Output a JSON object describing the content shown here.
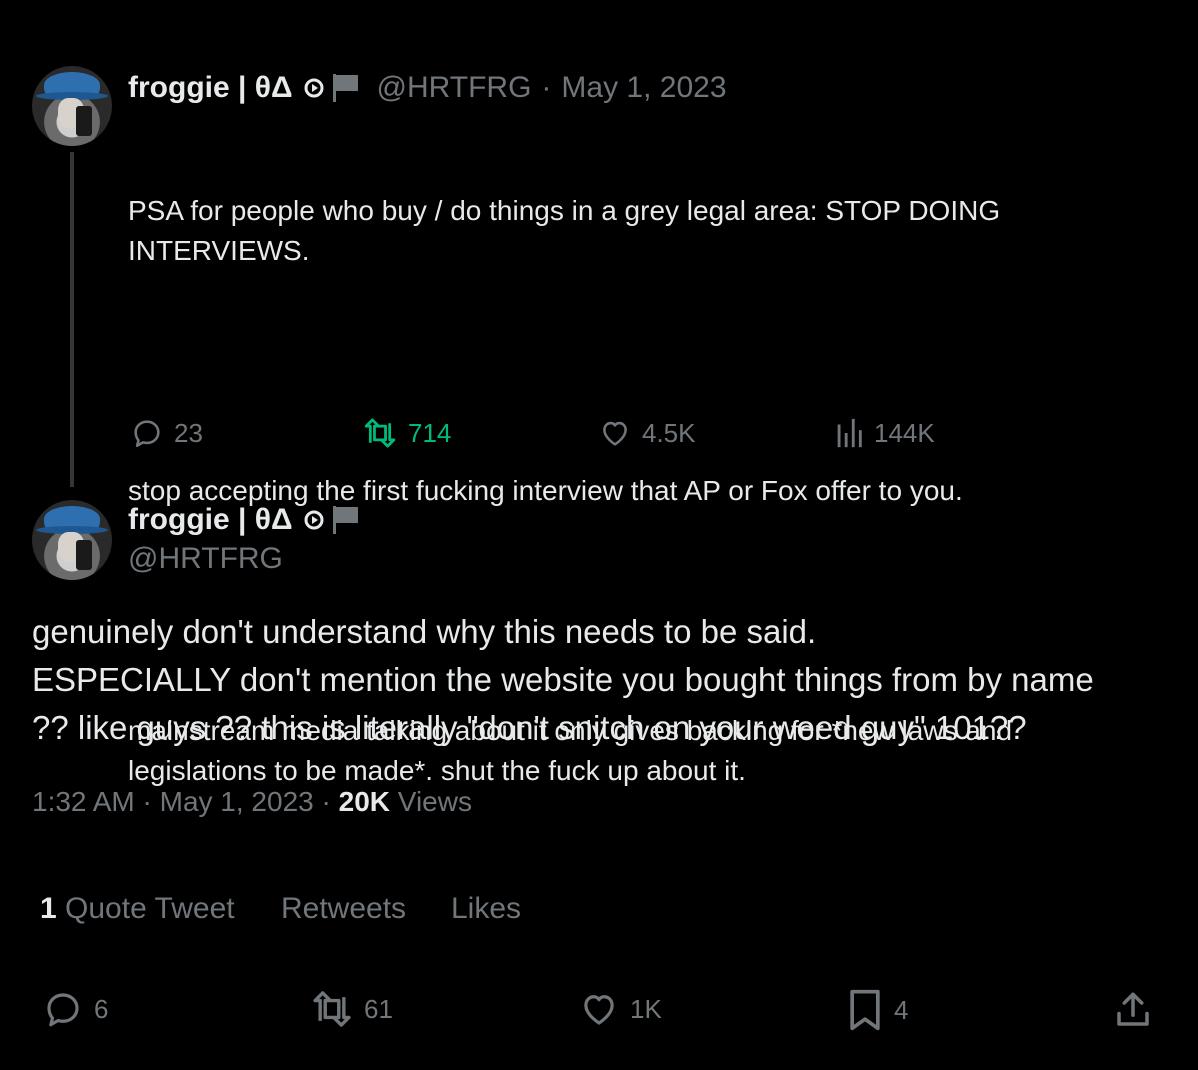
{
  "original_tweet": {
    "display_name": "froggie | θΔ",
    "handle": "@HRTFRG",
    "date_sep": "·",
    "date": "May 1, 2023",
    "paragraphs": [
      "PSA for people who buy / do things in a grey legal area: STOP DOING\nINTERVIEWS.",
      "stop accepting the first fucking interview that AP or Fox offer to you.",
      "mainstream media talking about it only gives backing for *new laws and\nlegislations to be made*. shut the fuck up about it."
    ],
    "stats": {
      "replies": "23",
      "retweets": "714",
      "likes": "4.5K",
      "views": "144K"
    }
  },
  "reply_tweet": {
    "display_name": "froggie | θΔ",
    "handle": "@HRTFRG",
    "text": "genuinely don't understand why this needs to be said.\nESPECIALLY don't mention the website you bought things from by name\n?? like guys ?? this is literally \"don't snitch on your weed guy\" 101??",
    "time": "1:32 AM",
    "sep1": "·",
    "date": "May 1, 2023",
    "sep2": "·",
    "views_count": "20K",
    "views_label": "Views"
  },
  "engagement_tabs": {
    "quote_count": "1",
    "quote_label": "Quote Tweet",
    "retweets_label": "Retweets",
    "likes_label": "Likes"
  },
  "actions": {
    "replies": "6",
    "retweets": "61",
    "likes": "1K",
    "bookmarks": "4"
  },
  "colors": {
    "background": "#000000",
    "text": "#e7e9ea",
    "muted": "#71767b",
    "retweet_active": "#00ba7c",
    "thread_line": "#333639"
  },
  "icons": [
    "reply-icon",
    "retweet-icon",
    "like-icon",
    "views-icon",
    "bookmark-icon",
    "share-icon",
    "play-badge-icon",
    "flag-icon"
  ]
}
